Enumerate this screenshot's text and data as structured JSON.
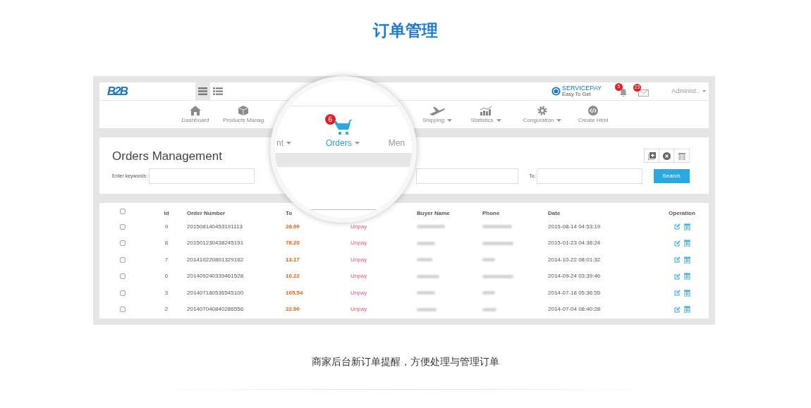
{
  "page_title": "订单管理",
  "topbar": {
    "logo": "B2B",
    "view_toggles": [
      {
        "selected": true
      },
      {
        "selected": false
      }
    ],
    "brand": "SERVICEPAY",
    "brand_tagline": "Easy To Get",
    "notification_badge": "5",
    "message_badge": "23",
    "user": "Administ.."
  },
  "nav": [
    {
      "label": "Dashboard",
      "dropdown": false
    },
    {
      "label": "Products Manag",
      "dropdown": false
    },
    {
      "label": "Shipping",
      "dropdown": true
    },
    {
      "label": "Statistics",
      "dropdown": true
    },
    {
      "label": "Conguration",
      "dropdown": true
    },
    {
      "label": "Create Html",
      "dropdown": false
    }
  ],
  "magnifier": {
    "cart_badge": "6",
    "items": [
      {
        "label": "nt",
        "dropdown": true,
        "selected": false
      },
      {
        "label": "Orders",
        "dropdown": true,
        "selected": true
      },
      {
        "label": "Men",
        "dropdown": false,
        "selected": false
      }
    ]
  },
  "panel": {
    "title": "Orders Management",
    "keyword_label": "Enter keywords:",
    "to_label": "To:",
    "search_button": "Search"
  },
  "table": {
    "header_checked": false,
    "columns": [
      {
        "label": "Id"
      },
      {
        "label": "Order Number"
      },
      {
        "label": "To"
      },
      {},
      {
        "label": "Buyer Name"
      },
      {
        "label": "Phone"
      },
      {
        "label": "Date"
      },
      {
        "label": "Operation"
      }
    ],
    "rows": [
      {
        "checked": false,
        "id": "9",
        "order_number": "201508140453191113",
        "total": "28.00",
        "status": "Unpay",
        "date": "2015-08-14 04:53:19"
      },
      {
        "checked": false,
        "id": "8",
        "order_number": "201501230438245191",
        "total": "78.20",
        "status": "Unpay",
        "date": "2015-01-23 04:38:24"
      },
      {
        "checked": false,
        "id": "7",
        "order_number": "201410220801329162",
        "total": "13.17",
        "status": "Unpay",
        "date": "2014-10-22 08:01:32"
      },
      {
        "checked": false,
        "id": "6",
        "order_number": "201409240339461528",
        "total": "10.22",
        "status": "Unpay",
        "date": "2014-09-24 03:39:46"
      },
      {
        "checked": false,
        "id": "3",
        "order_number": "201407180536545100",
        "total": "105.54",
        "status": "Unpay",
        "date": "2014-07-18 05:36:55"
      },
      {
        "checked": false,
        "id": "2",
        "order_number": "201407040840286556",
        "total": "22.00",
        "status": "Unpay",
        "date": "2014-07-04 08:40:28"
      }
    ]
  },
  "caption": "商家后台新订单提醒，方便处理与管理订单"
}
